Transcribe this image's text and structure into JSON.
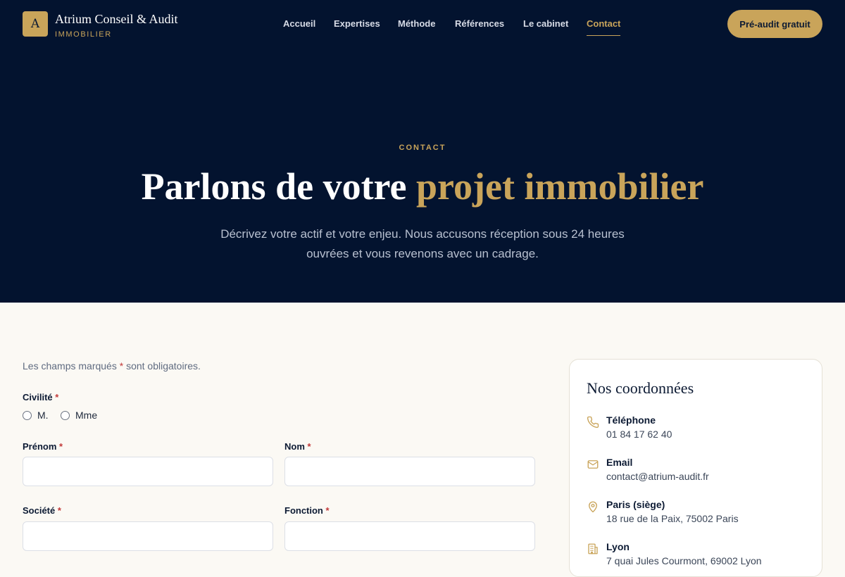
{
  "brand": {
    "logo_letter": "A",
    "name": "Atrium Conseil & Audit",
    "tagline": "IMMOBILIER"
  },
  "nav": {
    "items": [
      {
        "label": "Accueil"
      },
      {
        "label": "Expertises"
      },
      {
        "label": "Méthode"
      },
      {
        "label": "Références"
      },
      {
        "label": "Le cabinet"
      },
      {
        "label": "Contact",
        "active": true
      }
    ],
    "cta_label": "Pré-audit gratuit"
  },
  "hero": {
    "eyebrow": "CONTACT",
    "title_main": "Parlons de votre ",
    "title_accent": "projet immobilier",
    "subtitle": "Décrivez votre actif et votre enjeu. Nous accusons réception sous 24 heures ouvrées et vous revenons avec un cadrage."
  },
  "form": {
    "note_before": "Les champs marqués ",
    "required_mark": "*",
    "note_after": " sont obligatoires.",
    "civilite": {
      "label": "Civilité",
      "options": [
        "M.",
        "Mme"
      ]
    },
    "fields": {
      "prenom": {
        "label": "Prénom",
        "value": ""
      },
      "nom": {
        "label": "Nom",
        "value": ""
      },
      "societe": {
        "label": "Société",
        "value": ""
      },
      "fonction": {
        "label": "Fonction",
        "value": ""
      }
    }
  },
  "coordinates": {
    "title": "Nos coordonnées",
    "items": [
      {
        "icon": "phone-icon",
        "label": "Téléphone",
        "value": "01 84 17 62 40"
      },
      {
        "icon": "mail-icon",
        "label": "Email",
        "value": "contact@atrium-audit.fr"
      },
      {
        "icon": "map-pin-icon",
        "label": "Paris (siège)",
        "value": "18 rue de la Paix, 75002 Paris"
      },
      {
        "icon": "building-icon",
        "label": "Lyon",
        "value": "7 quai Jules Courmont, 69002 Lyon"
      }
    ]
  },
  "colors": {
    "navy": "#03132f",
    "gold": "#c9a45a",
    "cream": "#fbf9f4",
    "required_red": "#c23a3a"
  }
}
